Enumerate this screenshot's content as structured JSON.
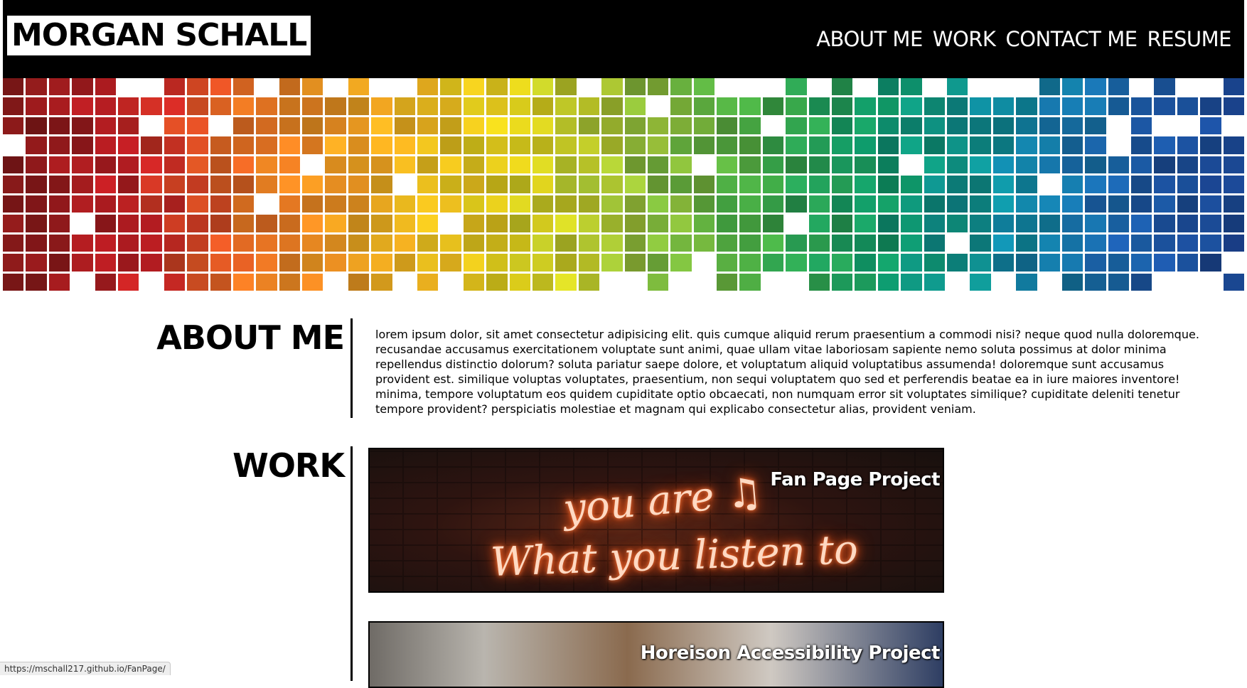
{
  "site": {
    "name": "MORGAN SCHALL"
  },
  "nav": {
    "items": [
      "ABOUT ME",
      "WORK",
      "CONTACT ME",
      "RESUME"
    ]
  },
  "about": {
    "heading": "ABOUT ME",
    "body": "lorem ipsum dolor, sit amet consectetur adipisicing elit. quis cumque aliquid rerum praesentium a commodi nisi? neque quod nulla doloremque. recusandae accusamus exercitationem voluptate sunt animi, quae ullam vitae laboriosam sapiente nemo soluta possimus at dolor minima repellendus distinctio dolorum? soluta pariatur saepe dolore, et voluptatum aliquid voluptatibus assumenda! doloremque sunt accusamus provident est. similique voluptas voluptates, praesentium, non sequi voluptatem quo sed et perferendis beatae ea in iure maiores inventore! minima, tempore voluptatum eos quidem cupiditate optio obcaecati, non numquam error sit voluptates similique? cupiditate deleniti tenetur tempore provident? perspiciatis molestiae et magnam qui explicabo consectetur alias, provident veniam."
  },
  "work": {
    "heading": "WORK",
    "projects": [
      {
        "title": "Fan Page Project",
        "image_text": [
          "you are ♫",
          "What you listen to"
        ]
      },
      {
        "title": "Horeison Accessibility Project"
      }
    ]
  },
  "status_bar": {
    "url": "https://mschall217.github.io/FanPage/"
  },
  "colors": {
    "header_bg": "#000000",
    "page_bg": "#ffffff",
    "banner_gradient": [
      "#8b1a1a",
      "#c41e24",
      "#f07b24",
      "#f5b121",
      "#e8d81c",
      "#9cc43a",
      "#3fa845",
      "#0e9a6a",
      "#0f8fa8",
      "#1d5fae",
      "#1a3f8a"
    ]
  }
}
